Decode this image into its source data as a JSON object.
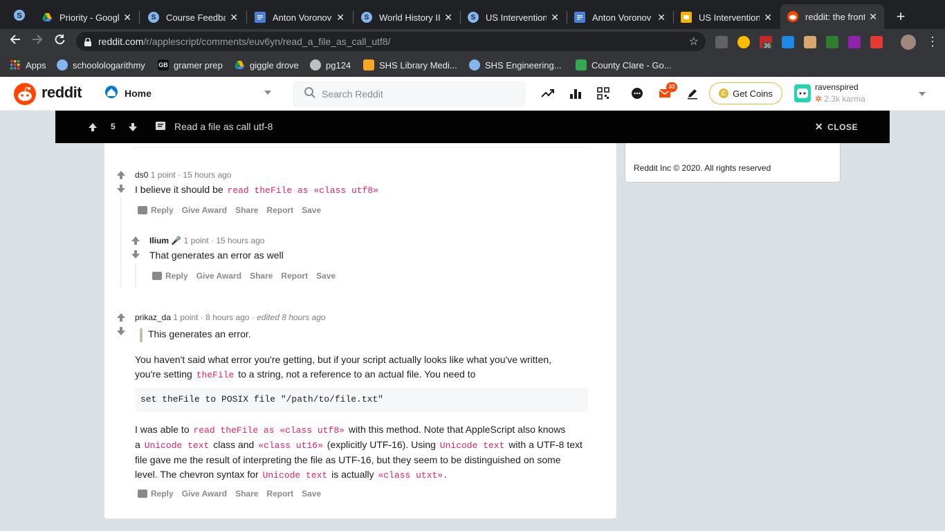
{
  "browser": {
    "tabs": [
      {
        "title": "Priority - Google",
        "icon": "google-drive-icon",
        "color": "#f4b400"
      },
      {
        "title": "Course Feedbac",
        "icon": "schoology-icon",
        "color": "#83b5ef"
      },
      {
        "title": "Anton Voronov",
        "icon": "google-docs-icon",
        "color": "#4a7fdc"
      },
      {
        "title": "World History II:",
        "icon": "schoology-icon",
        "color": "#83b5ef"
      },
      {
        "title": "US Intervention",
        "icon": "schoology-icon",
        "color": "#83b5ef"
      },
      {
        "title": "Anton Voronov",
        "icon": "google-docs-icon",
        "color": "#4a7fdc"
      },
      {
        "title": "US Intervention",
        "icon": "google-slides-icon",
        "color": "#f4b400"
      },
      {
        "title": "reddit: the front",
        "icon": "reddit-icon",
        "color": "#ff4500"
      }
    ],
    "url": "reddit.com/r/applescript/comments/euv6yn/read_a_file_as_call_utf8/",
    "url_host": "reddit.com",
    "url_path": "/r/applescript/comments/euv6yn/read_a_file_as_call_utf8/",
    "extension_badge": "36",
    "bookmarks": [
      {
        "label": "Apps",
        "icon": "apps-grid-icon"
      },
      {
        "label": "schoolologarithmy",
        "icon": "schoology-icon"
      },
      {
        "label": "gramer prep",
        "icon": "gb-icon"
      },
      {
        "label": "giggle drove",
        "icon": "google-drive-icon"
      },
      {
        "label": "pg124",
        "icon": "globe-icon"
      },
      {
        "label": "SHS Library Medi...",
        "icon": "library-icon"
      },
      {
        "label": "SHS Engineering...",
        "icon": "schoology-icon"
      },
      {
        "label": "County Clare - Go...",
        "icon": "maps-icon"
      }
    ]
  },
  "reddit_header": {
    "wordmark": "reddit",
    "home_label": "Home",
    "search_placeholder": "Search Reddit",
    "mail_badge": "33",
    "coins_label": "Get Coins",
    "username": "ravenspired",
    "karma": "2.3k karma",
    "accent": "#ff4500"
  },
  "post_bar": {
    "score": "5",
    "title": "Read a file as call utf-8",
    "close_label": "CLOSE"
  },
  "sidebar": {
    "copyright": "Reddit Inc © 2020. All rights reserved"
  },
  "comments": [
    {
      "author": "ds0",
      "points": "1 point",
      "time": "15 hours ago",
      "text_before": "I believe it should be ",
      "code": "read theFile as «class utf8»",
      "actions": [
        "Reply",
        "Give Award",
        "Share",
        "Report",
        "Save"
      ]
    },
    {
      "author": "Ilium",
      "points": "1 point",
      "time": "15 hours ago",
      "text": "That generates an error as well",
      "actions": [
        "Reply",
        "Give Award",
        "Share",
        "Report",
        "Save"
      ]
    },
    {
      "author": "prikaz_da",
      "points": "1 point",
      "time": "8 hours ago",
      "edited": "edited 8 hours ago",
      "quote": "This generates an error.",
      "p1_a": "You haven't said what error you're getting, but if your script actually looks like what you've written,",
      "p1_b": "you're setting ",
      "p1_code": "theFile",
      "p1_c": " to a string, not a reference to an actual file. You need to",
      "codeblock": "set theFile to POSIX file \"/path/to/file.txt\"",
      "p2_a": "I was able to ",
      "p2_code1": "read theFile as «class utf8»",
      "p2_b": " with this method. Note that AppleScript also knows",
      "p2_c": "a ",
      "p2_code2": "Unicode text",
      "p2_d": " class and ",
      "p2_code3": "«class ut16»",
      "p2_e": " (explicitly UTF-16). Using ",
      "p2_code4": "Unicode text",
      "p2_f": " with a UTF-8 text",
      "p2_g": "file gave me the result of interpreting the file as UTF-16, but they seem to be distinguished on some",
      "p2_h": "level. The chevron syntax for ",
      "p2_code5": "Unicode text",
      "p2_i": " is actually ",
      "p2_code6": "«class utxt»",
      "p2_j": ".",
      "actions": [
        "Reply",
        "Give Award",
        "Share",
        "Report",
        "Save"
      ]
    }
  ]
}
